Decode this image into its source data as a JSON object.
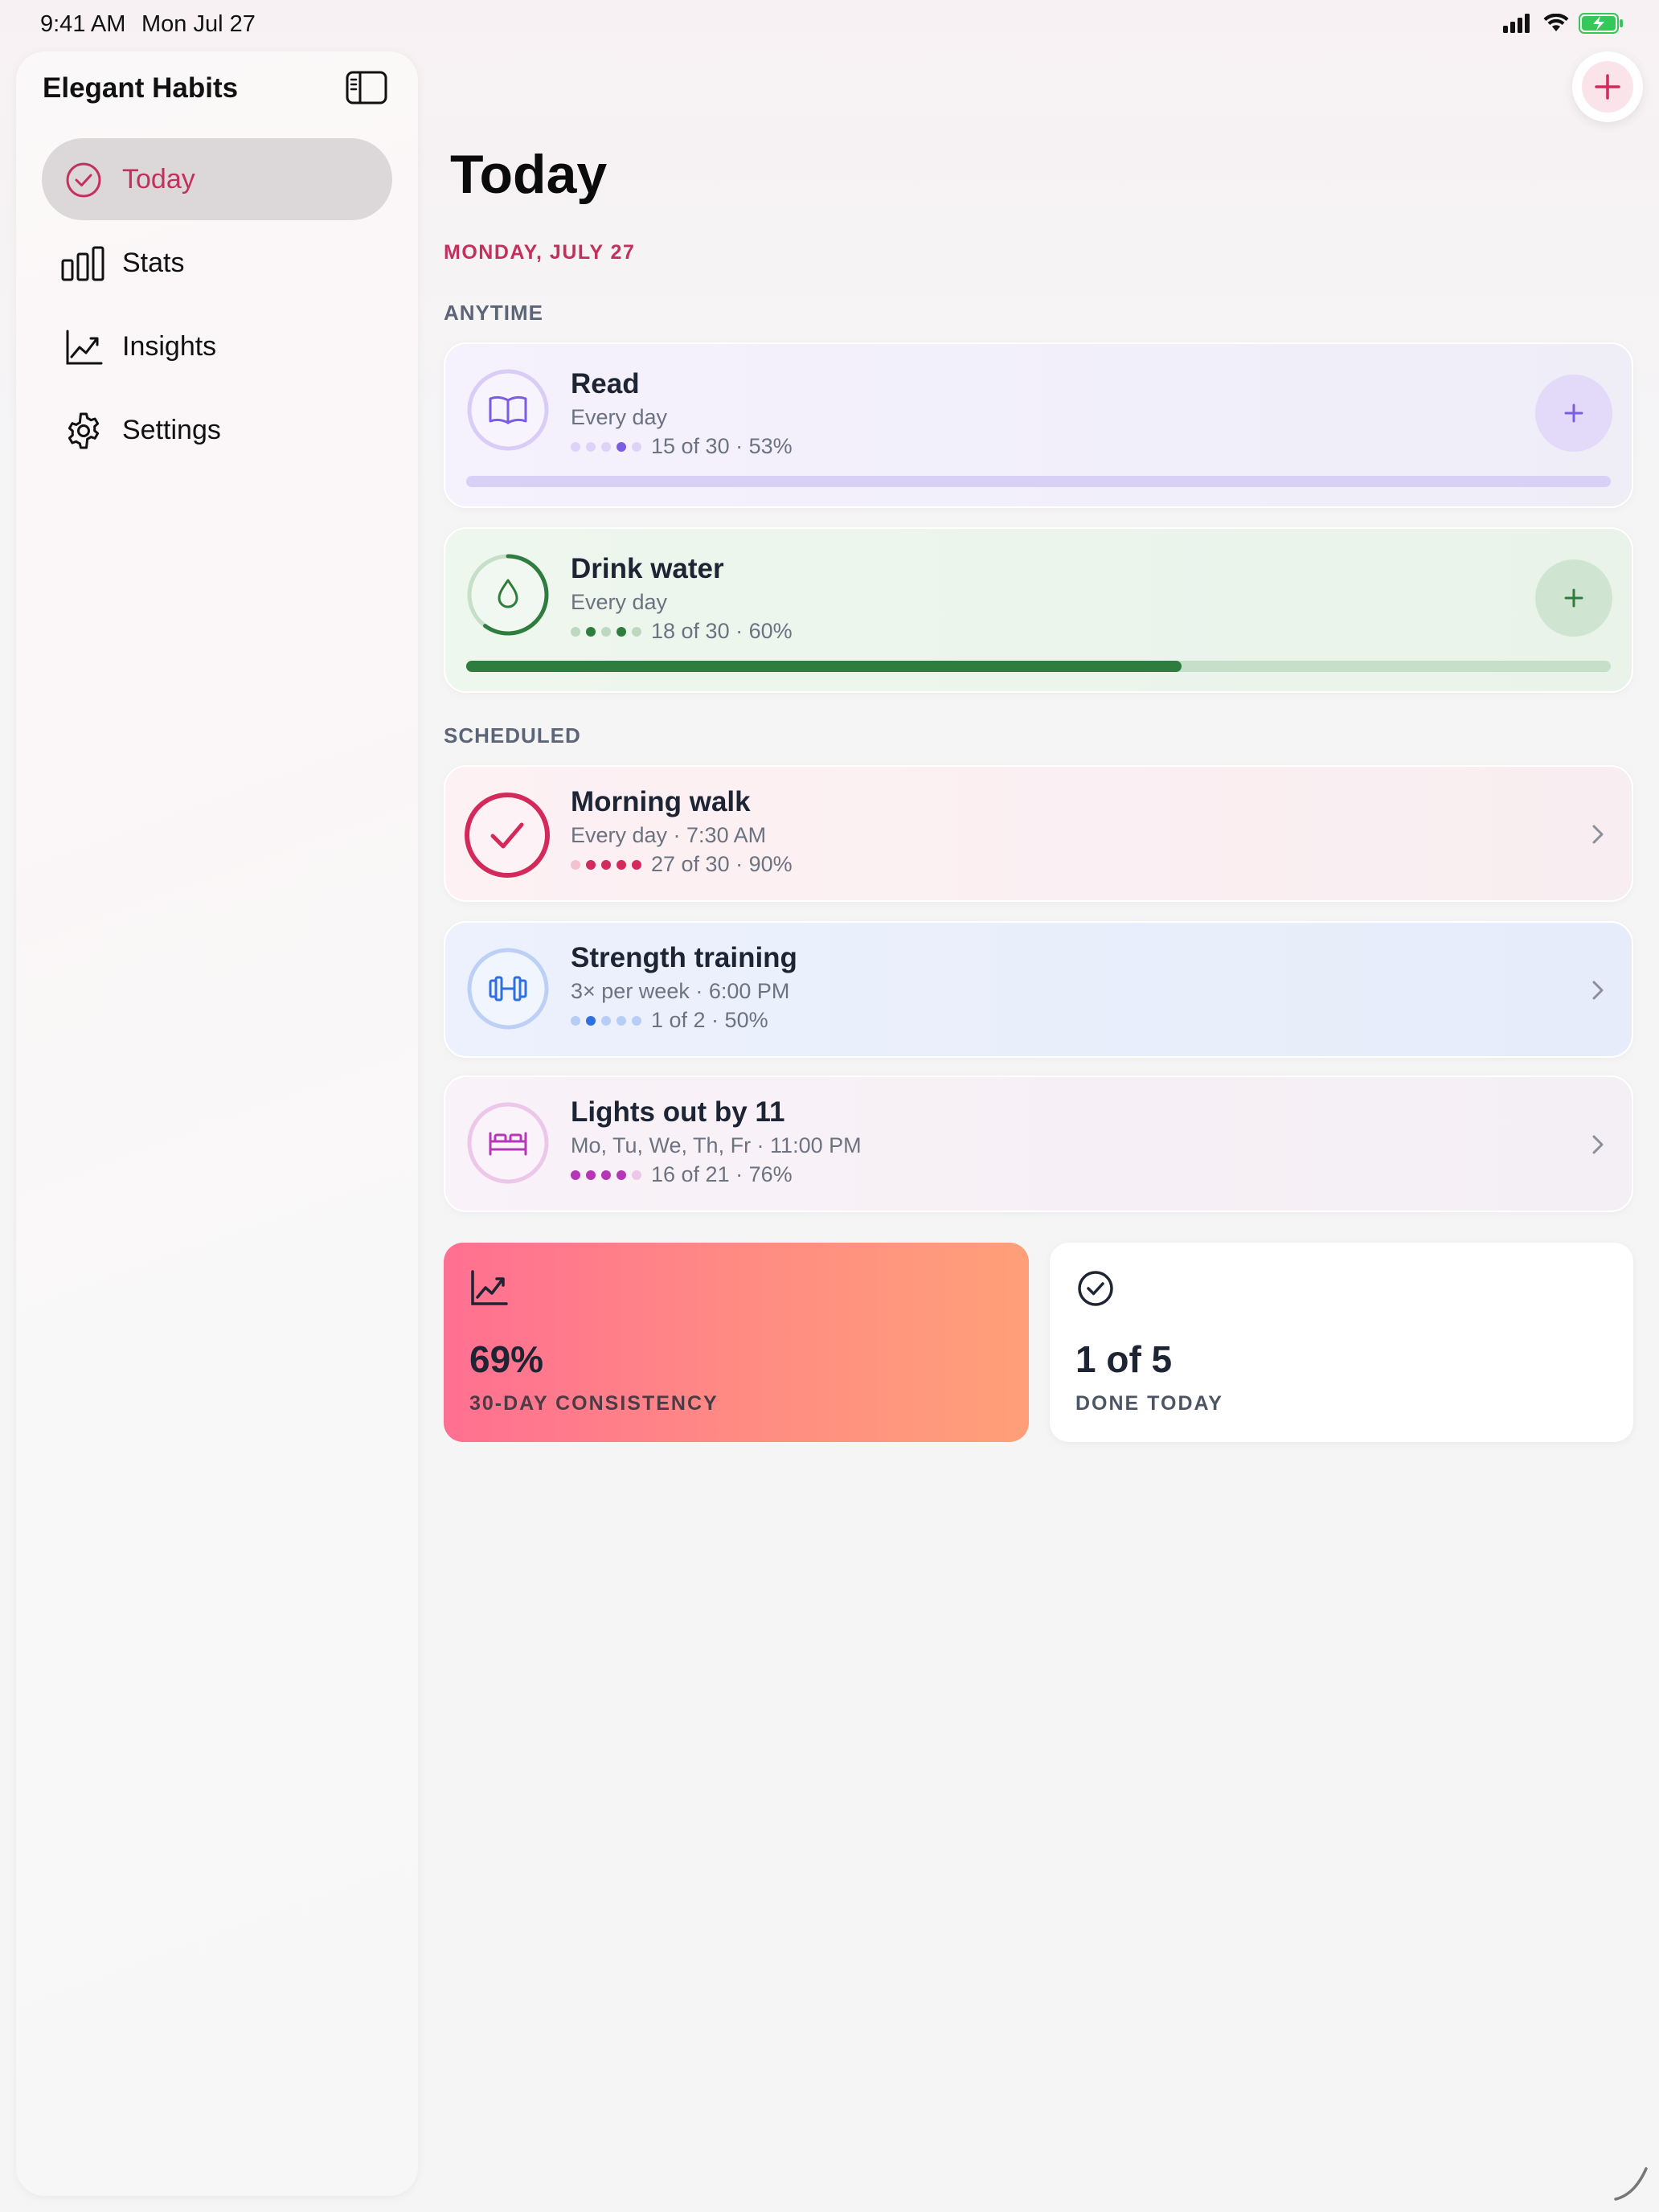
{
  "status_bar": {
    "time": "9:41 AM",
    "date": "Mon Jul 27",
    "icons": [
      "cellular-signal-icon",
      "wifi-icon",
      "battery-charging-icon"
    ]
  },
  "sidebar": {
    "title": "Elegant Habits",
    "toggle_icon": "sidebar-toggle-icon",
    "items": [
      {
        "label": "Today",
        "icon": "checkmark-circle-icon",
        "active": true
      },
      {
        "label": "Stats",
        "icon": "bar-chart-icon",
        "active": false
      },
      {
        "label": "Insights",
        "icon": "trend-line-icon",
        "active": false
      },
      {
        "label": "Settings",
        "icon": "gear-icon",
        "active": false
      }
    ]
  },
  "main": {
    "title": "Today",
    "date": "MONDAY, JULY 27",
    "add_icon": "plus-icon",
    "sections": {
      "anytime": "ANYTIME",
      "scheduled": "SCHEDULED"
    },
    "habits": {
      "read": {
        "name": "Read",
        "schedule": "Every day",
        "progress_text": "15 of 30 · 53%",
        "progress": 0.0,
        "icon": "book-icon",
        "accent": "#7c5ce0"
      },
      "water": {
        "name": "Drink water",
        "schedule": "Every day",
        "progress_text": "18 of 30 · 60%",
        "progress": 0.625,
        "icon": "water-drop-icon",
        "accent": "#2e7d3e"
      },
      "walk": {
        "name": "Morning walk",
        "schedule": "Every day · 7:30 AM",
        "progress_text": "27 of 30 · 90%",
        "icon": "checkmark-icon",
        "accent": "#d42a5b",
        "done": true
      },
      "strength": {
        "name": "Strength training",
        "schedule": "3× per week · 6:00 PM",
        "progress_text": "1 of 2 · 50%",
        "icon": "dumbbell-icon",
        "accent": "#2f6fe0"
      },
      "lights": {
        "name": "Lights out by 11",
        "schedule": "Mo, Tu, We, Th, Fr · 11:00 PM",
        "progress_text": "16 of 21 · 76%",
        "icon": "bed-icon",
        "accent": "#b637b5"
      }
    },
    "stats": {
      "consistency": {
        "value": "69%",
        "label": "30-DAY CONSISTENCY",
        "icon": "trend-line-icon"
      },
      "done_today": {
        "value": "1 of 5",
        "label": "DONE TODAY",
        "icon": "checkmark-circle-icon"
      }
    }
  },
  "colors": {
    "brand": "#c4305e",
    "read": "#7c5ce0",
    "water": "#2e7d3e",
    "walk": "#d42a5b",
    "strength": "#2f6fe0",
    "lights": "#b637b5"
  }
}
